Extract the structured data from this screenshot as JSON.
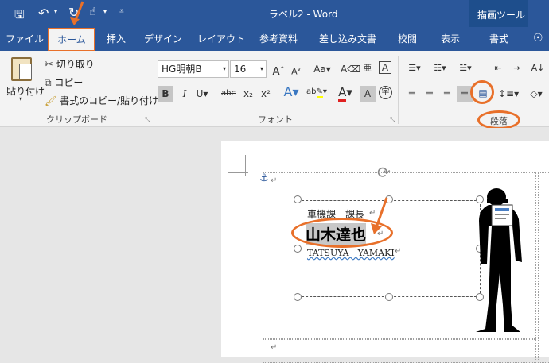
{
  "titlebar": {
    "doc_title": "ラベル2 - Word",
    "context_tool_label": "描画ツール",
    "qat_icons": [
      "save-icon",
      "undo-icon",
      "redo-icon",
      "touch-mode-icon",
      "customize-icon"
    ]
  },
  "tabs": [
    "ファイル",
    "ホーム",
    "挿入",
    "デザイン",
    "レイアウト",
    "参考資料",
    "差し込み文書",
    "校閲",
    "表示",
    "書式"
  ],
  "ribbon": {
    "clipboard": {
      "paste_label": "貼り付け",
      "cut_label": "切り取り",
      "copy_label": "コピー",
      "format_painter_label": "書式のコピー/貼り付け",
      "group_label": "クリップボード"
    },
    "font": {
      "font_name": "HG明朝B",
      "font_size": "16",
      "group_label": "フォント"
    },
    "paragraph": {
      "group_label": "段落"
    }
  },
  "document": {
    "line1": "車機課　課長",
    "name": "山木達也",
    "romaji": "TATSUYA　YAMAKI"
  },
  "colors": {
    "accent": "#2b579a",
    "annotation": "#e8702a"
  }
}
